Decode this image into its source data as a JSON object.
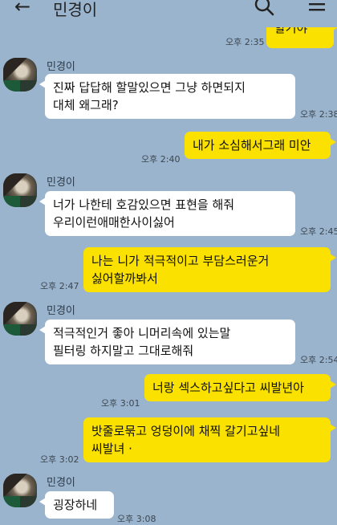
{
  "header": {
    "back_label": "←",
    "title": "민경이",
    "search_icon": "search-icon",
    "menu_icon": "menu-icon"
  },
  "messages": [
    {
      "from": "me",
      "lines": [
        "할거야"
      ],
      "time": "오후 2:35"
    },
    {
      "from": "them",
      "name": "민경이",
      "lines": [
        "진짜 답답해 할말있으면 그냥 하면되지",
        "대체 왜그래?"
      ],
      "time": "오후 2:38"
    },
    {
      "from": "me",
      "lines": [
        "내가 소심해서그래 미안"
      ],
      "time": "오후 2:40"
    },
    {
      "from": "them",
      "name": "민경이",
      "lines": [
        "너가 나한테 호감있으면 표현을 해줘",
        "우리이런애매한사이싫어"
      ],
      "time": "오후 2:45"
    },
    {
      "from": "me",
      "lines": [
        "나는 니가 적극적이고 부담스러운거",
        "싫어할까봐서"
      ],
      "time": "오후 2:47"
    },
    {
      "from": "them",
      "name": "민경이",
      "lines": [
        "적극적인거 좋아 니머리속에 있는말",
        "필터링 하지말고 그대로해줘"
      ],
      "time": "오후 2:54"
    },
    {
      "from": "me",
      "lines": [
        "너랑 섹스하고싶다고 씨발년아"
      ],
      "time": "오후 3:01"
    },
    {
      "from": "me",
      "lines": [
        "밧줄로묶고 엉덩이에 채찍 갈기고싶네",
        "씨발녀 ·"
      ],
      "time": "오후 3:02"
    },
    {
      "from": "them",
      "name": "민경이",
      "lines": [
        "굉장하네"
      ],
      "time": "오후 3:08"
    }
  ],
  "colors": {
    "background": "#9bb4cd",
    "my_bubble": "#fae100",
    "their_bubble": "#ffffff"
  }
}
